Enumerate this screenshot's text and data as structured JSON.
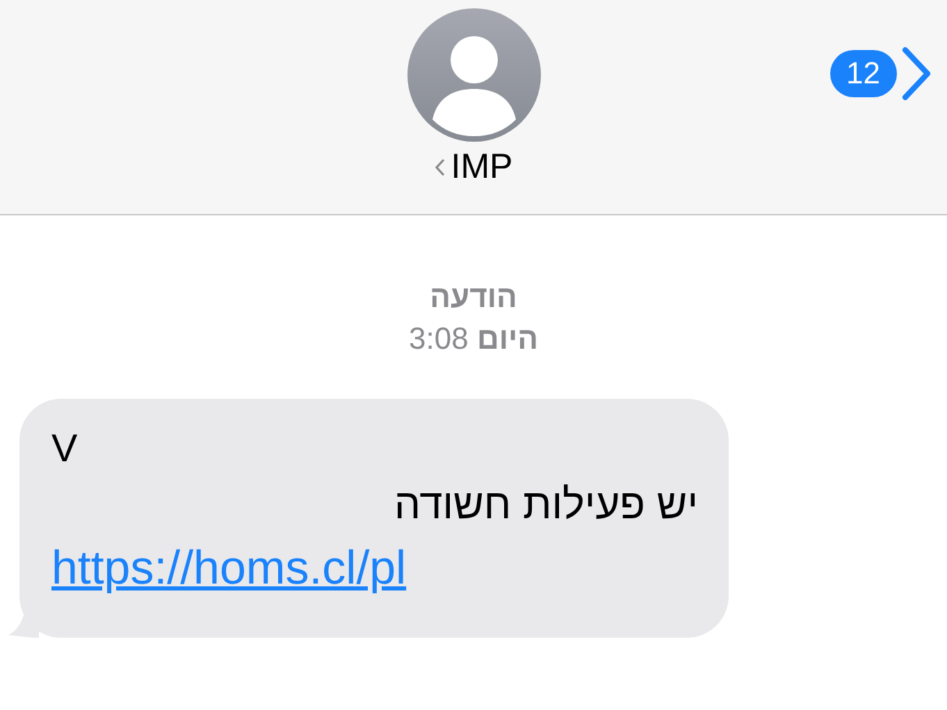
{
  "header": {
    "contact_name": "IMP",
    "unread_count": "12"
  },
  "timestamp": {
    "label": "הודעה",
    "time": "**היום** 3:08"
  },
  "message": {
    "lines": [
      {
        "kind": "latin",
        "text": "V"
      },
      {
        "kind": "hebrew",
        "text": "יש פעילות חשודה"
      },
      {
        "kind": "link",
        "text": "https://homs.cl/pl"
      }
    ]
  }
}
